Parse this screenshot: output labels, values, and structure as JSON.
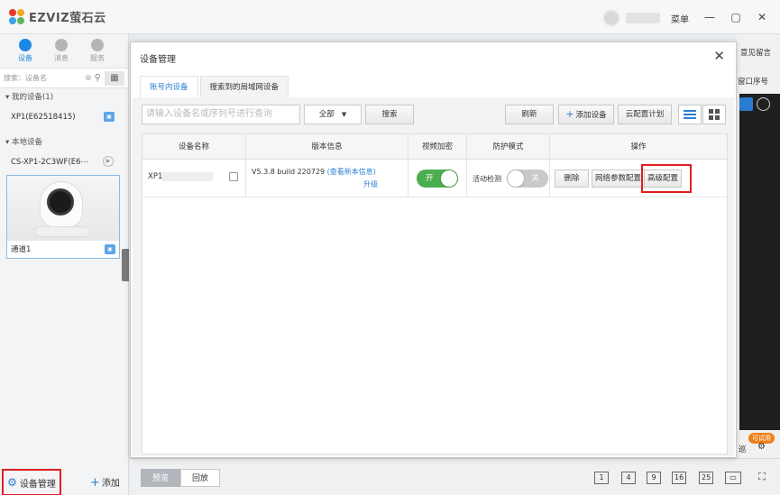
{
  "app": {
    "logo_text": "EZVIZ萤石云",
    "menu_label": "菜单",
    "min": "—",
    "max": "▢",
    "close": "✕"
  },
  "colors": {
    "accent": "#2a7fd4",
    "highlight": "#e02020",
    "toggle_on": "#4cae4f"
  },
  "sidebar": {
    "tabs": [
      {
        "label": "设备"
      },
      {
        "label": "消息"
      },
      {
        "label": "服务"
      }
    ],
    "search_placeholder": "搜索：设备名",
    "group_mine": "我的设备(1)",
    "my_device": "XP1(E62518415)",
    "group_local": "本地设备",
    "local_device": "CS-XP1-2C3WF(E6⋯",
    "channel_label": "通道1",
    "manage_label": "设备管理",
    "add_label": "添加"
  },
  "right_panel": {
    "feedback": "意见留言",
    "window_order": "窗口序号",
    "trial": "可试用",
    "patrol": "巡"
  },
  "bottom_bar": {
    "preview": "预览",
    "playback": "回放",
    "layouts": [
      "1",
      "4",
      "9",
      "16",
      "25"
    ]
  },
  "dialog": {
    "title": "设备管理",
    "close": "✕",
    "tabs": [
      {
        "label": "账号内设备",
        "active": true
      },
      {
        "label": "搜索到的局域网设备",
        "active": false
      }
    ],
    "search_placeholder": "请输入设备名或序列号进行查询",
    "filter_value": "全部",
    "search_btn": "搜索",
    "refresh_btn": "刷新",
    "add_device_btn": "添加设备",
    "cloud_plan_btn": "云配置计划",
    "columns": [
      "设备名称",
      "版本信息",
      "视频加密",
      "防护模式",
      "操作"
    ],
    "row": {
      "name": "XP1",
      "version": "V5.3.8 build 220729",
      "version_link": "(查看新本信息)",
      "upgrade": "升级",
      "encrypt_toggle": "开",
      "guard_label": "活动检测",
      "guard_toggle": "关",
      "actions": {
        "delete": "删除",
        "network": "网络参数配置",
        "advanced": "高级配置"
      }
    }
  }
}
